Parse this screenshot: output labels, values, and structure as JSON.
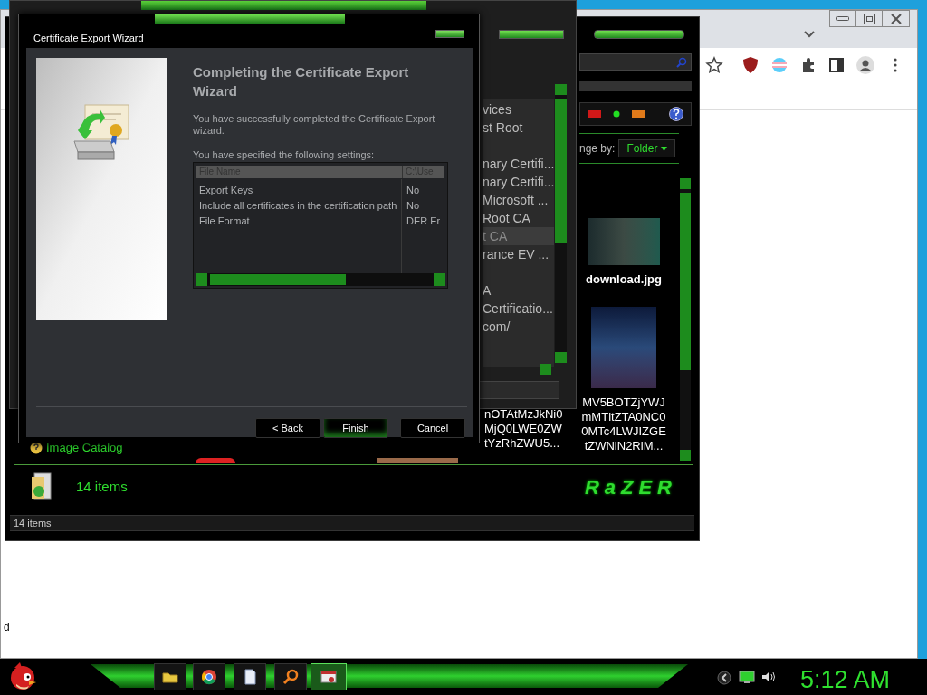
{
  "browser": {
    "edge_text": "d"
  },
  "explorer": {
    "arrange_label": "nge by:",
    "arrange_value": "Folder",
    "items": [
      {
        "name": "download.jpg",
        "kind": "photo"
      },
      {
        "name": "MV5BOTZjYWJ mMTltZTA0NC0 0MTc4LWJIZGE tZWNlN2RiM...",
        "kind": "poster"
      }
    ],
    "partial_item_name": "nOTAtMzJkNi0 MjQ0LWE0ZW tYzRhZWU5...",
    "catalog_link": "Image Catalog",
    "info_count": "14 items",
    "logo": "RaZER",
    "status": "14 items"
  },
  "cert_manager": {
    "rows": [
      {
        "kind": "text",
        "text": "vices",
        "selected": false
      },
      {
        "kind": "text",
        "text": "st Root",
        "selected": false
      },
      {
        "kind": "blank"
      },
      {
        "kind": "text",
        "text": "nary Certifi...",
        "selected": false
      },
      {
        "kind": "text",
        "text": "nary Certifi...",
        "selected": false
      },
      {
        "kind": "text",
        "text": "Microsoft ...",
        "selected": false
      },
      {
        "kind": "text",
        "text": "Root CA",
        "selected": false
      },
      {
        "kind": "text",
        "text": "t CA",
        "selected": true
      },
      {
        "kind": "text",
        "text": "rance EV ...",
        "selected": false
      },
      {
        "kind": "blank"
      },
      {
        "kind": "text",
        "text": "A",
        "selected": false
      },
      {
        "kind": "text",
        "text": "Certificatio...",
        "selected": false
      },
      {
        "kind": "text",
        "text": "com/",
        "selected": false
      }
    ]
  },
  "dialog": {
    "title": "Certificate Export Wizard",
    "heading": "Completing the Certificate Export Wizard",
    "message": "You have successfully completed the Certificate Export wizard.",
    "settings_label": "You have specified the following settings:",
    "settings": {
      "columns": [
        "File Name",
        "C:\\Use"
      ],
      "rows": [
        [
          "Export Keys",
          "No"
        ],
        [
          "Include all certificates in the certification path",
          "No"
        ],
        [
          "File Format",
          "DER Er"
        ]
      ]
    },
    "buttons": [
      {
        "label": "< Back",
        "focused": false
      },
      {
        "label": "Finish",
        "focused": true
      },
      {
        "label": "Cancel",
        "focused": false
      }
    ]
  },
  "taskbar": {
    "tasks": [
      {
        "kind": "folder",
        "active": false
      },
      {
        "kind": "chrome",
        "active": false
      },
      {
        "kind": "document",
        "active": false
      },
      {
        "kind": "search",
        "active": false
      },
      {
        "kind": "certificate",
        "active": true
      }
    ],
    "clock": "5:12 AM"
  }
}
